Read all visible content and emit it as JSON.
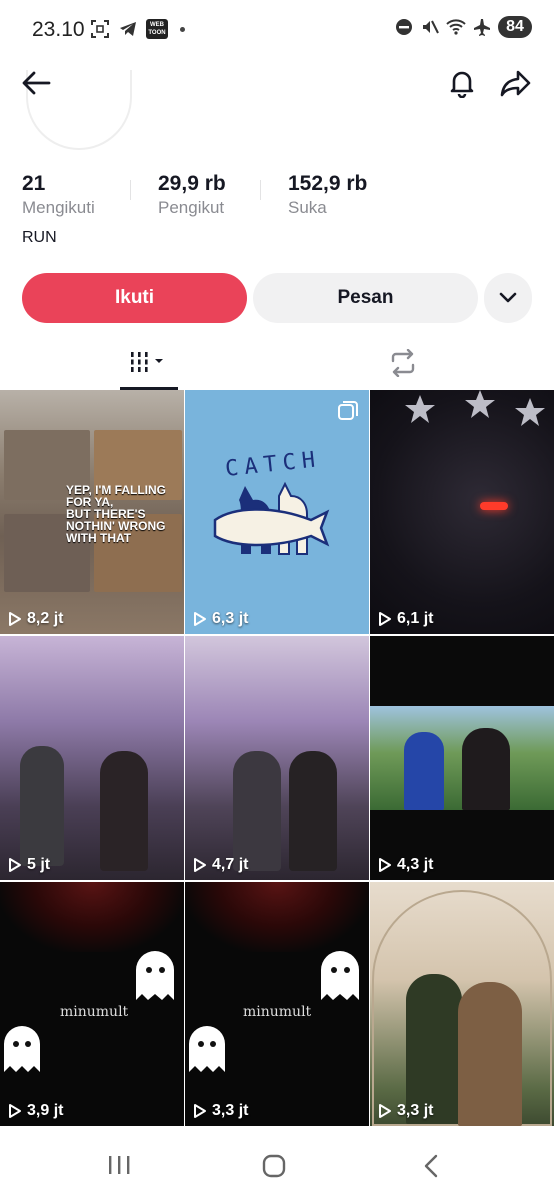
{
  "status_bar": {
    "time": "23.10",
    "webtoon_label": "WEB TOON",
    "battery": "84"
  },
  "profile": {
    "stats": [
      {
        "value": "21",
        "label": "Mengikuti"
      },
      {
        "value": "29,9 rb",
        "label": "Pengikut"
      },
      {
        "value": "152,9 rb",
        "label": "Suka"
      }
    ],
    "bio": "RUN"
  },
  "actions": {
    "follow_label": "Ikuti",
    "message_label": "Pesan"
  },
  "tabs": [
    {
      "name": "videos",
      "icon": "grid-icon",
      "active": true
    },
    {
      "name": "reposts",
      "icon": "repost-icon",
      "active": false
    }
  ],
  "videos": [
    {
      "views": "8,2 jt",
      "caption_1": "YEP, I'M FALLING FOR YA,",
      "caption_2": "BUT THERE'S NOTHIN' WRONG WITH THAT"
    },
    {
      "views": "6,3 jt",
      "overlay_text": "CATCH",
      "multi_image": true
    },
    {
      "views": "6,1 jt"
    },
    {
      "views": "5 jt"
    },
    {
      "views": "4,7 jt"
    },
    {
      "views": "4,3 jt"
    },
    {
      "views": "3,9 jt",
      "overlay_text": "minumult"
    },
    {
      "views": "3,3 jt",
      "overlay_text": "minumult"
    },
    {
      "views": "3,3 jt"
    }
  ],
  "colors": {
    "accent": "#ea4359",
    "secondary_button": "#f1f1f2",
    "text_primary": "#161823",
    "text_secondary": "#8a8b91"
  }
}
